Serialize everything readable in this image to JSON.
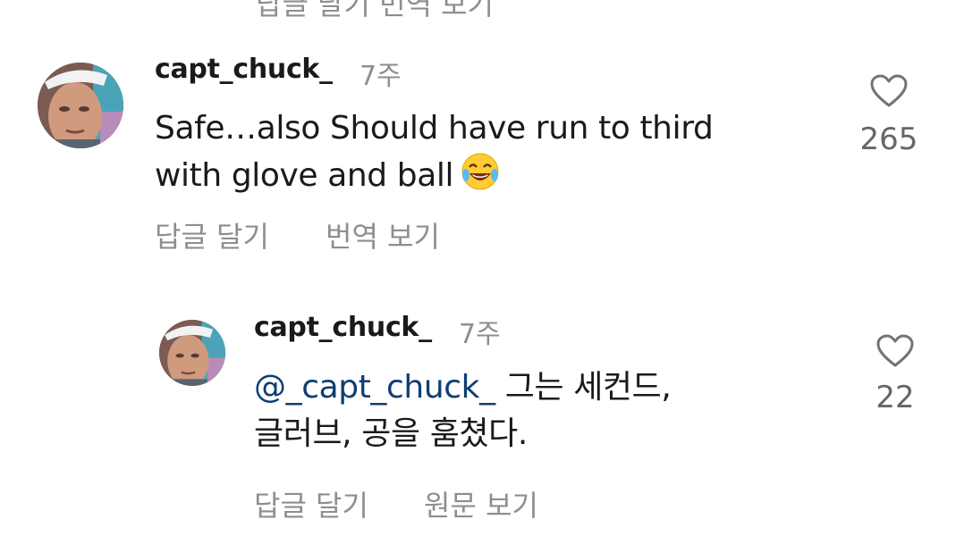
{
  "previous_comment": {
    "actions_text": "답글 달기 번역 보기"
  },
  "comments": [
    {
      "username": "capt_chuck_",
      "time": "7주",
      "text_line1": "Safe…also Should have run to third",
      "text_line2": "with glove and ball",
      "emoji_icon": "face-with-tears-of-joy-icon",
      "reply_label": "답글 달기",
      "translate_label": "번역 보기",
      "likes": "265"
    },
    {
      "username": "capt_chuck_",
      "time": "7주",
      "mention": "@_capt_chuck_",
      "text_line1_rest": " 그는 세컨드,",
      "text_line2": "글러브, 공을 훔쳤다.",
      "reply_label": "답글 달기",
      "original_label": "원문 보기",
      "likes": "22"
    }
  ],
  "colors": {
    "text": "#1a1a1a",
    "muted": "#8e8e8e",
    "mention": "#0f3d73",
    "likes": "#666666"
  }
}
